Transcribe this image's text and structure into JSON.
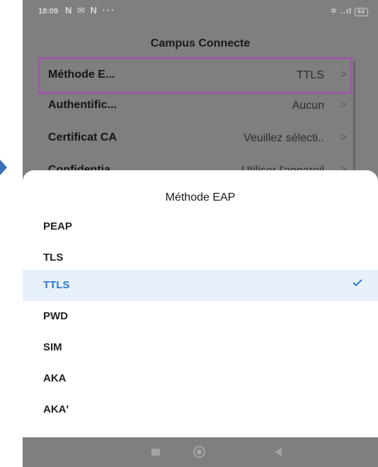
{
  "status_bar": {
    "time": "18:09",
    "left_icons": "N ✉ N ···",
    "right_icons": "✲ ..ıl",
    "battery": "60"
  },
  "screen": {
    "title": "Campus Connecte"
  },
  "settings": {
    "rows": [
      {
        "label": "Méthode E...",
        "value": "TTLS",
        "chevron": ">"
      },
      {
        "label": "Authentific...",
        "value": "Aucun",
        "chevron": ">"
      },
      {
        "label": "Certificat CA",
        "value": "Veuillez sélecti..",
        "chevron": ">"
      },
      {
        "label": "Confidentia...",
        "value": "Utiliser l'appareil",
        "chevron": ">"
      }
    ]
  },
  "sheet": {
    "title": "Méthode EAP",
    "options": [
      {
        "label": "PEAP"
      },
      {
        "label": "TLS"
      },
      {
        "label": "TTLS",
        "selected": true
      },
      {
        "label": "PWD"
      },
      {
        "label": "SIM"
      },
      {
        "label": "AKA"
      },
      {
        "label": "AKA'"
      }
    ]
  },
  "colors": {
    "highlight_border": "#9d56a8",
    "selected_text": "#2b7ad6",
    "selected_bg": "#e8f1fb",
    "dim_overlay": "#7f7f7f",
    "pointer_arrow": "#3b6fb7"
  },
  "icons": {
    "check": "check-icon",
    "chevron": "chevron-right-icon",
    "nav_recent": "square-icon",
    "nav_home": "circle-icon",
    "nav_back": "back-triangle-icon"
  }
}
